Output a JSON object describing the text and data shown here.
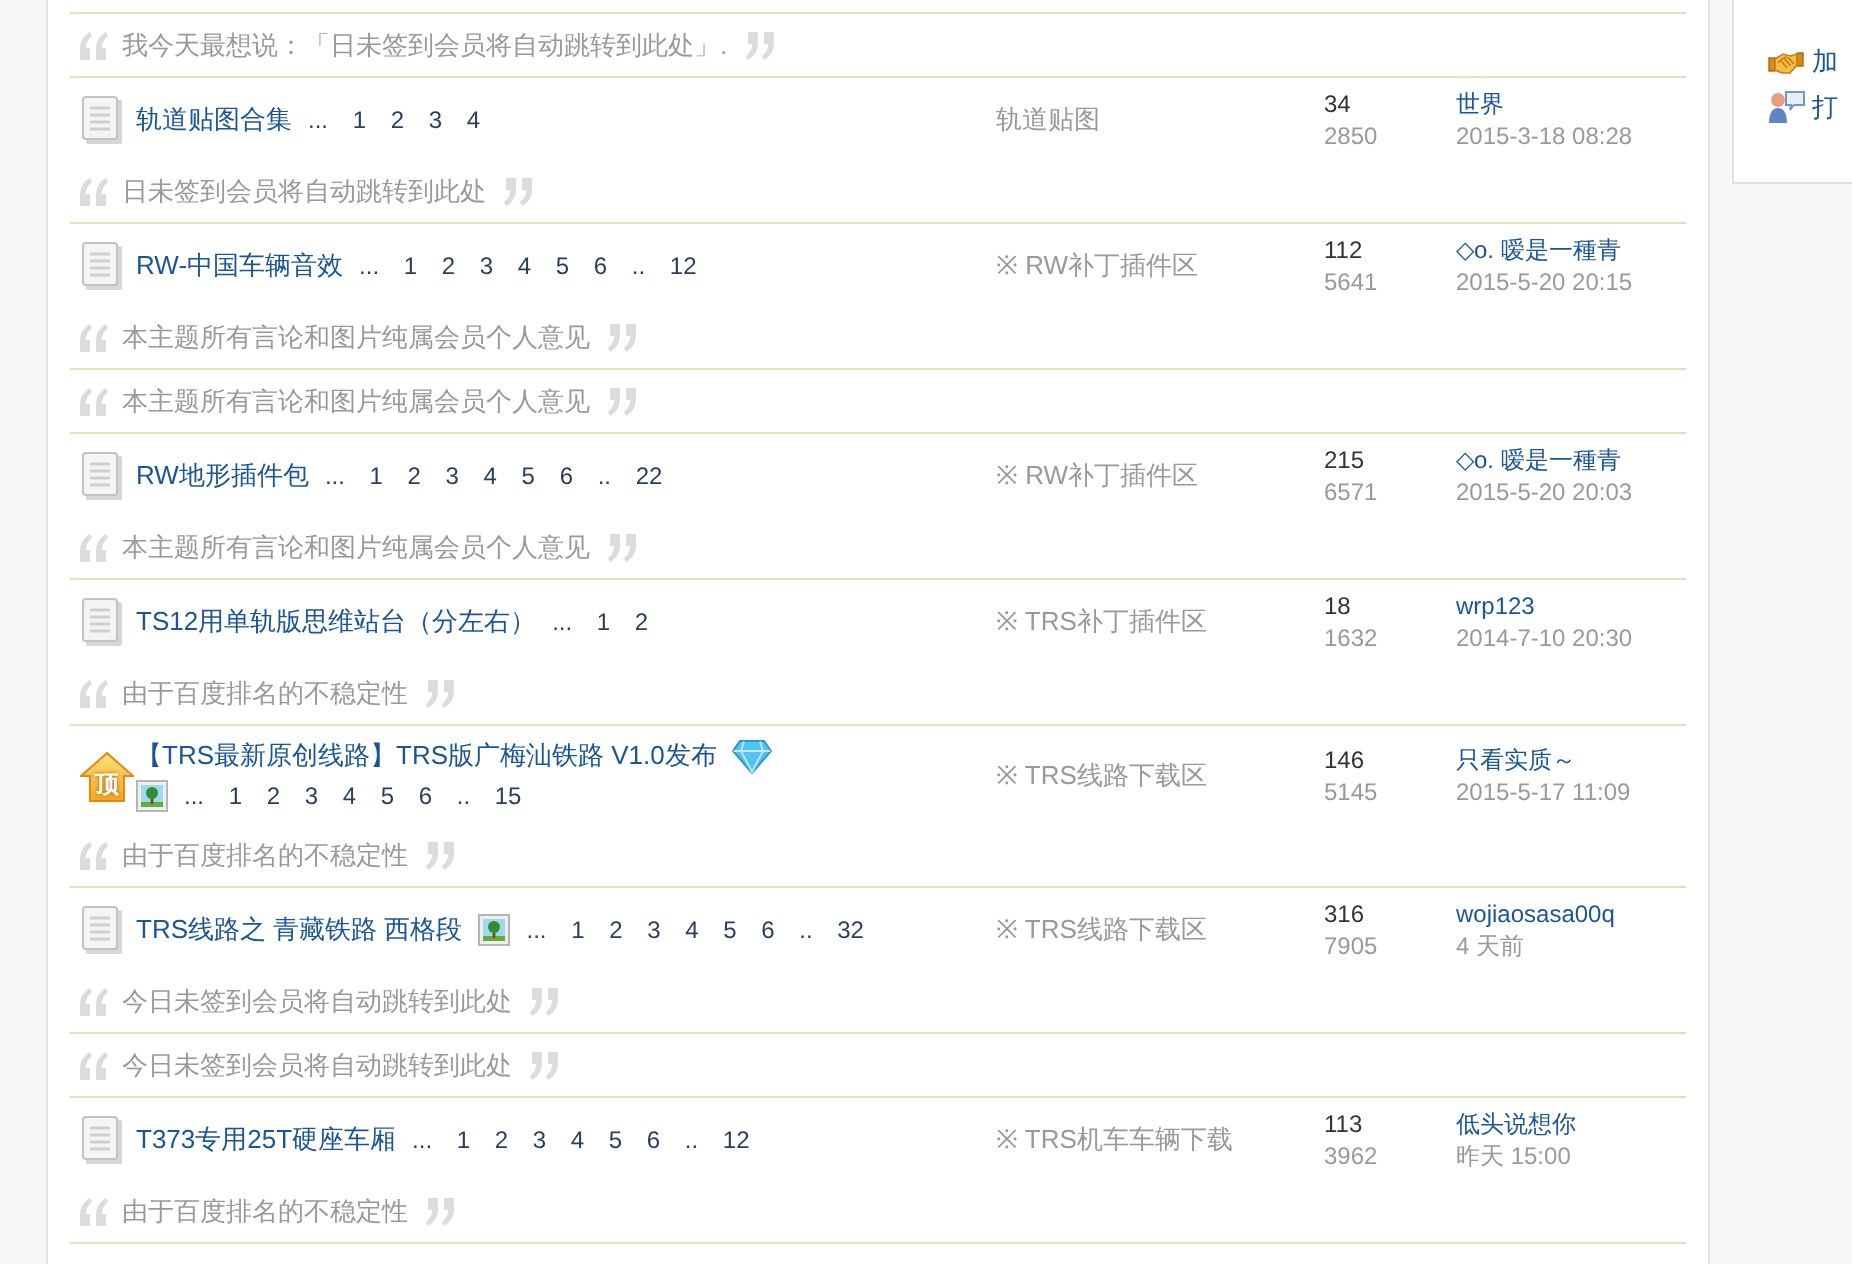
{
  "rows": [
    {
      "kind": "quote",
      "text": "我今天最想说：「日未签到会员将自动跳转到此处」."
    },
    {
      "kind": "thread",
      "sticky": false,
      "title": "轨道贴图合集",
      "digest": false,
      "has_image": false,
      "pagination": "... 1 2 3 4",
      "forum": "轨道贴图",
      "replies": "34",
      "views": "2850",
      "last_poster": "世界",
      "last_time": "2015-3-18 08:28",
      "signature": "日未签到会员将自动跳转到此处"
    },
    {
      "kind": "thread",
      "sticky": false,
      "title": "RW-中国车辆音效",
      "digest": false,
      "has_image": false,
      "pagination": "... 1 2 3 4 5 6 .. 12",
      "forum": "※ RW补丁插件区",
      "replies": "112",
      "views": "5641",
      "last_poster": "◇o. 嗳是一種青",
      "last_time": "2015-5-20 20:15",
      "signature": "本主题所有言论和图片纯属会员个人意见"
    },
    {
      "kind": "quote",
      "text": "本主题所有言论和图片纯属会员个人意见"
    },
    {
      "kind": "thread",
      "sticky": false,
      "title": "RW地形插件包",
      "digest": false,
      "has_image": false,
      "pagination": "... 1 2 3 4 5 6 .. 22",
      "forum": "※ RW补丁插件区",
      "replies": "215",
      "views": "6571",
      "last_poster": "◇o. 嗳是一種青",
      "last_time": "2015-5-20 20:03",
      "signature": "本主题所有言论和图片纯属会员个人意见"
    },
    {
      "kind": "thread",
      "sticky": false,
      "title": "TS12用单轨版思维站台（分左右）",
      "digest": false,
      "has_image": false,
      "pagination": "... 1 2",
      "forum": "※ TRS补丁插件区",
      "replies": "18",
      "views": "1632",
      "last_poster": "wrp123",
      "last_time": "2014-7-10 20:30",
      "signature": "由于百度排名的不稳定性"
    },
    {
      "kind": "thread",
      "sticky": true,
      "sticky_label": "顶",
      "title": "【TRS最新原创线路】TRS版广梅汕铁路 V1.0发布",
      "digest": true,
      "has_image": true,
      "pagination": "... 1 2 3 4 5 6 .. 15",
      "forum": "※ TRS线路下载区",
      "replies": "146",
      "views": "5145",
      "last_poster": "只看实质～",
      "last_time": "2015-5-17 11:09",
      "signature": "由于百度排名的不稳定性"
    },
    {
      "kind": "thread",
      "sticky": false,
      "title": "TRS线路之 青藏铁路 西格段",
      "digest": false,
      "has_image": true,
      "pagination": "... 1 2 3 4 5 6 .. 32",
      "forum": "※ TRS线路下载区",
      "replies": "316",
      "views": "7905",
      "last_poster": "wojiaosasa00q",
      "last_time": "4 天前",
      "signature": "今日未签到会员将自动跳转到此处"
    },
    {
      "kind": "quote",
      "text": "今日未签到会员将自动跳转到此处"
    },
    {
      "kind": "thread",
      "sticky": false,
      "title": "T373专用25T硬座车厢",
      "digest": false,
      "has_image": false,
      "pagination": "... 1 2 3 4 5 6 .. 12",
      "forum": "※ TRS机车车辆下载",
      "replies": "113",
      "views": "3962",
      "last_poster": "低头说想你",
      "last_time": "昨天 15:00",
      "signature": "由于百度排名的不稳定性"
    }
  ],
  "sidebar": {
    "links": [
      {
        "label": "加"
      },
      {
        "label": "打"
      }
    ]
  }
}
